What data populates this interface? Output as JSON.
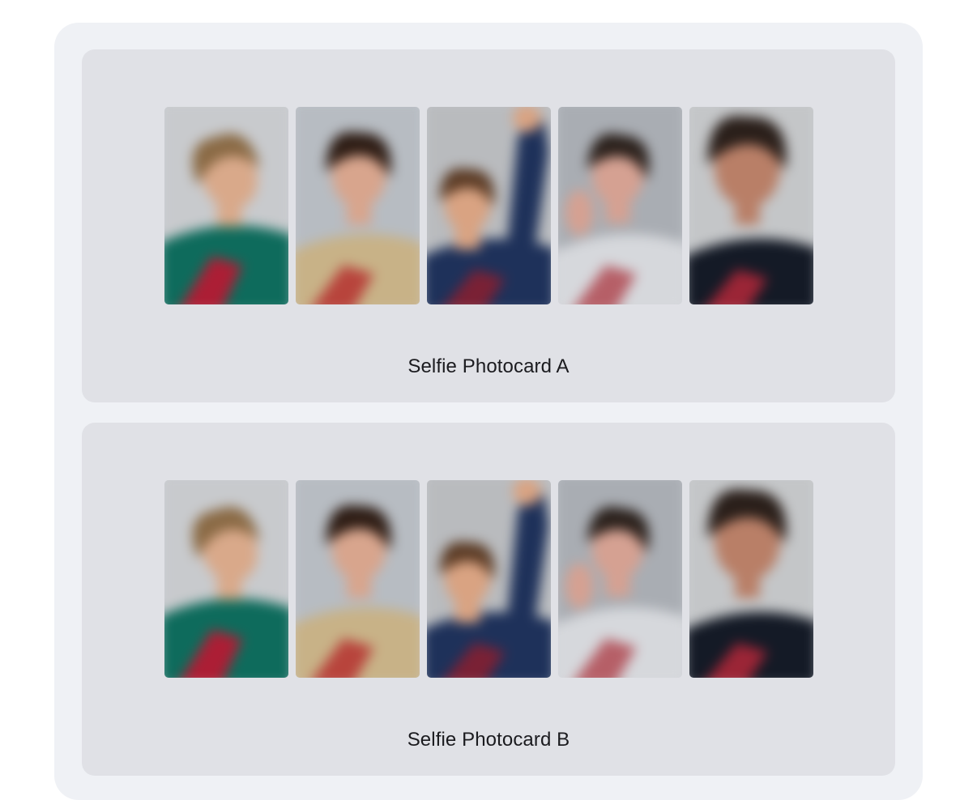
{
  "products": [
    {
      "caption": "Selfie Photocard A",
      "photos": [
        {
          "icon": "photocard-member-1",
          "bg": "#c8cacd",
          "hair": "#8a6a45",
          "skin": "#d9a98a",
          "top": "#0e6b5c",
          "accent": "#c8102e"
        },
        {
          "icon": "photocard-member-2",
          "bg": "#b7bcc2",
          "hair": "#2e1d15",
          "skin": "#d8a58d",
          "top": "#c8b287",
          "accent": "#b5302f"
        },
        {
          "icon": "photocard-member-3",
          "bg": "#b9bbbe",
          "hair": "#5c3c26",
          "skin": "#d9a382",
          "top": "#1e315a",
          "accent": "#8b1f2f"
        },
        {
          "icon": "photocard-member-4",
          "bg": "#a9adb3",
          "hair": "#2b211c",
          "skin": "#d5a192",
          "top": "#d6d8dc",
          "accent": "#b04a52"
        },
        {
          "icon": "photocard-member-5",
          "bg": "#c4c6c8",
          "hair": "#2a1f1a",
          "skin": "#b97f67",
          "top": "#141a26",
          "accent": "#b3283a"
        }
      ]
    },
    {
      "caption": "Selfie Photocard B",
      "photos": [
        {
          "icon": "photocard-member-1",
          "bg": "#c8cacd",
          "hair": "#8a6a45",
          "skin": "#d9a98a",
          "top": "#0e6b5c",
          "accent": "#c8102e"
        },
        {
          "icon": "photocard-member-2",
          "bg": "#b7bcc2",
          "hair": "#2e1d15",
          "skin": "#d8a58d",
          "top": "#c8b287",
          "accent": "#b5302f"
        },
        {
          "icon": "photocard-member-3",
          "bg": "#b9bbbe",
          "hair": "#5c3c26",
          "skin": "#d9a382",
          "top": "#1e315a",
          "accent": "#8b1f2f"
        },
        {
          "icon": "photocard-member-4",
          "bg": "#a9adb3",
          "hair": "#2b211c",
          "skin": "#d5a192",
          "top": "#d6d8dc",
          "accent": "#b04a52"
        },
        {
          "icon": "photocard-member-5",
          "bg": "#c4c6c8",
          "hair": "#2a1f1a",
          "skin": "#b97f67",
          "top": "#141a26",
          "accent": "#b3283a"
        }
      ]
    }
  ]
}
